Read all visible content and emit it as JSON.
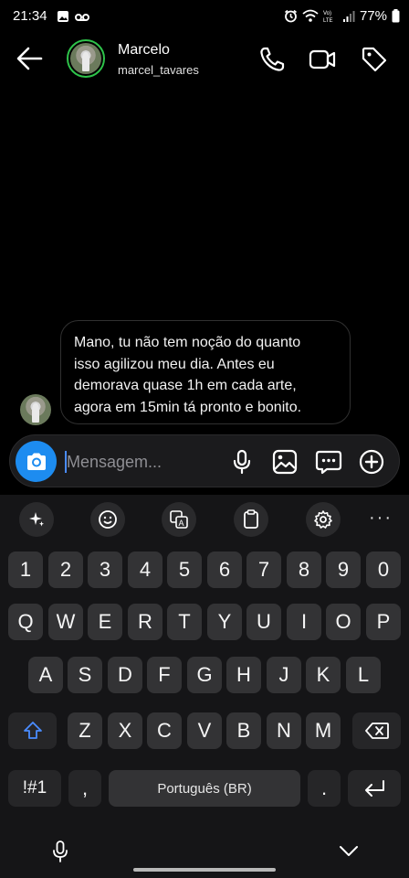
{
  "status_bar": {
    "time": "21:34",
    "battery": "77%",
    "icons": [
      "image-icon",
      "voicemail-icon",
      "alarm-icon",
      "wifi-icon",
      "volte-icon",
      "signal-icon",
      "battery-icon"
    ]
  },
  "header": {
    "name": "Marcelo",
    "username": "marcel_tavares",
    "icons": [
      "back-arrow-icon",
      "phone-icon",
      "video-icon",
      "tag-icon"
    ],
    "ring_color": "#2ec34a"
  },
  "message": {
    "lines": [
      "Mano, tu não tem noção do quanto",
      "isso agilizou meu dia. Antes eu",
      "demorava quase 1h em cada arte,",
      "agora em 15min tá pronto e bonito."
    ]
  },
  "composer": {
    "placeholder": "Mensagem...",
    "value": "",
    "accent": "#1d8cf0",
    "icons": [
      "camera-icon",
      "microphone-icon",
      "gallery-icon",
      "sticker-icon",
      "plus-icon"
    ]
  },
  "keyboard": {
    "toolbar": [
      "ai-sparkle-icon",
      "emoji-icon",
      "translate-icon",
      "clipboard-icon",
      "settings-icon",
      "more-icon"
    ],
    "more_label": "···",
    "row_numbers": [
      "1",
      "2",
      "3",
      "4",
      "5",
      "6",
      "7",
      "8",
      "9",
      "0"
    ],
    "row1": [
      "Q",
      "W",
      "E",
      "R",
      "T",
      "Y",
      "U",
      "I",
      "O",
      "P"
    ],
    "row2": [
      "A",
      "S",
      "D",
      "F",
      "G",
      "H",
      "J",
      "K",
      "L"
    ],
    "row3": [
      "Z",
      "X",
      "C",
      "V",
      "B",
      "N",
      "M"
    ],
    "symbols_label": "!#1",
    "comma_label": ",",
    "space_label": "Português (BR)",
    "period_label": ".",
    "shift_color": "#4a8cff"
  }
}
